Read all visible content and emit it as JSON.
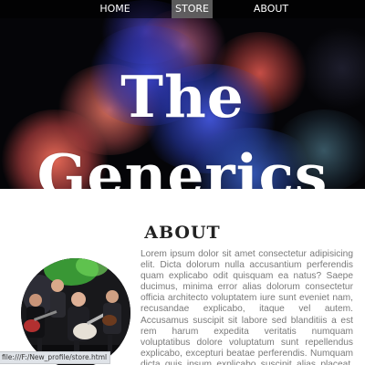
{
  "nav": {
    "home": "HOME",
    "store": "STORE",
    "about": "ABOUT",
    "active": "STORE"
  },
  "hero": {
    "line1": "The",
    "line2": "Generics"
  },
  "about": {
    "heading": "ABOUT",
    "body": "Lorem ipsum dolor sit amet consectetur adipisicing elit. Dicta dolorum nulla accusantium perferendis quam explicabo odit quisquam ea natus? Saepe ducimus, minima error alias dolorum consectetur officia architecto voluptatem iure sunt eveniet nam, recusandae explicabo, itaque vel autem. Accusamus suscipit sit labore sed blanditiis a est rem harum expedita veritatis numquam voluptatibus dolore voluptatum sunt repellendus explicabo, excepturi beatae perferendis. Numquam dicta quis ipsum explicabo suscipit alias placeat, ea, vero minus"
  },
  "status_bar": {
    "url": "file:///F:/New_profile/store.html"
  },
  "colors": {
    "nav_active_bg": "#787878",
    "hero_bg": "#050508",
    "body_text": "#7a7a7a",
    "heading_text": "#222222"
  }
}
